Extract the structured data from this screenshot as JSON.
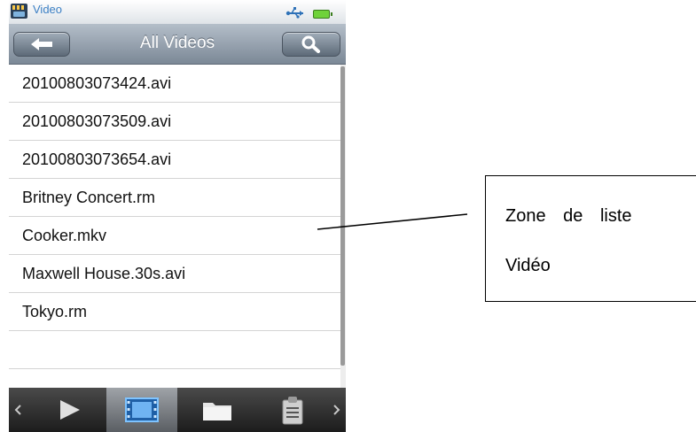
{
  "status_bar": {
    "app_title": "Video",
    "icons": [
      "video-app-icon",
      "usb-icon",
      "battery-icon"
    ]
  },
  "header": {
    "title": "All Videos",
    "back_icon": "left-arrow-icon",
    "search_icon": "search-icon"
  },
  "list": {
    "items": [
      "20100803073424.avi",
      "20100803073509.avi",
      "20100803073654.avi",
      "Britney Concert.rm",
      "Cooker.mkv",
      "Maxwell House.30s.avi",
      "Tokyo.rm",
      ""
    ]
  },
  "toolbar": {
    "items": [
      "scroll-left-icon",
      "play-icon",
      "video-film-icon",
      "folder-icon",
      "clipboard-icon",
      "scroll-right-icon"
    ],
    "selected": "video-film-icon"
  },
  "callout": {
    "line1": "Zone de liste",
    "line2": "Vidéo"
  },
  "colors": {
    "title_bar": "#8e9aa7",
    "toolbar": "#2e2e2e",
    "selected_tab": "#7d8187",
    "app_title": "#3b7fc4",
    "battery": "#6fd23a"
  }
}
